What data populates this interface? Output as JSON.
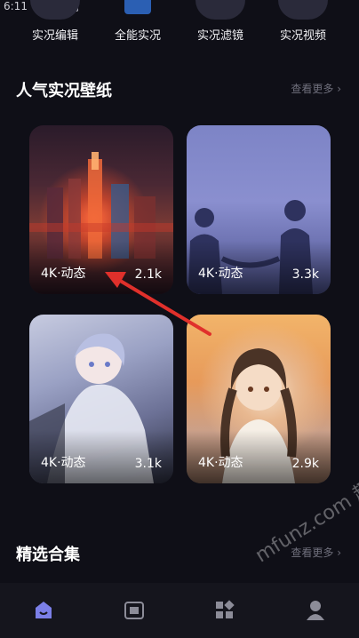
{
  "status": {
    "time": "6:11"
  },
  "top_actions": [
    {
      "label": "实况编辑"
    },
    {
      "label": "全能实况"
    },
    {
      "label": "实况滤镜"
    },
    {
      "label": "实况视频"
    }
  ],
  "popular": {
    "title": "人气实况壁纸",
    "more": "查看更多 ›",
    "cards": [
      {
        "tag": "4K·动态",
        "count": "2.1k"
      },
      {
        "tag": "4K·动态",
        "count": "3.3k"
      },
      {
        "tag": "4K·动态",
        "count": "3.1k"
      },
      {
        "tag": "4K·动态",
        "count": "2.9k"
      }
    ]
  },
  "collections": {
    "title": "精选合集",
    "more": "查看更多 ›"
  },
  "watermark": "mfunz.com 趣网",
  "nav": [
    {
      "icon": "home-icon"
    },
    {
      "icon": "wallpaper-icon"
    },
    {
      "icon": "apps-icon"
    },
    {
      "icon": "profile-icon"
    }
  ],
  "colors": {
    "accent": "#7b7fe8",
    "background": "#0f0f17",
    "arrow": "#e0302b"
  }
}
